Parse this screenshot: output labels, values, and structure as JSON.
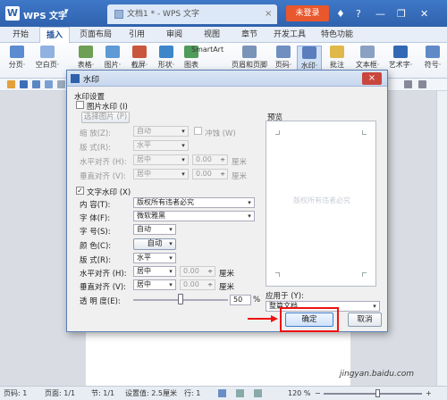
{
  "titlebar": {
    "app_logo": "W",
    "app_name": "WPS 文字",
    "menu_arrow": "▾",
    "doc_tab": "文档1 * - WPS 文字",
    "doc_tab_close": "×",
    "login_button": "未登录",
    "icons": [
      "skin-icon",
      "help-icon",
      "minimize-icon",
      "restore-icon",
      "close-icon"
    ],
    "icon_glyphs": [
      "♦",
      "?",
      "—",
      "❐",
      "✕"
    ]
  },
  "ribbon_tabs": [
    "开始",
    "插入",
    "页面布局",
    "引用",
    "审阅",
    "视图",
    "章节",
    "开发工具",
    "特色功能"
  ],
  "active_tab": "插入",
  "ribbon": {
    "groups": [
      {
        "label": "分页·",
        "color": "#5b8bd0"
      },
      {
        "label": "空白页·",
        "color": "#8fb2e0"
      },
      {
        "label": "表格·",
        "color": "#6d9f55"
      },
      {
        "label": "图片·",
        "color": "#5e9ad6"
      },
      {
        "label": "截屏·",
        "color": "#c9573d"
      },
      {
        "label": "形状·",
        "color": "#3d86c9"
      },
      {
        "label": "图表",
        "color": "#4f9c5a"
      },
      {
        "label": "页眉和页脚",
        "color": "#7a93b8"
      },
      {
        "label": "页码·",
        "color": "#6f8fc0"
      },
      {
        "label": "水印·",
        "color": "#5a7dbd"
      },
      {
        "label": "批注",
        "color": "#e0b84a"
      },
      {
        "label": "文本框·",
        "color": "#8aa1c4"
      },
      {
        "label": "艺术字·",
        "color": "#3269b5"
      },
      {
        "label": "符号·",
        "color": "#5f8ac7"
      }
    ],
    "smartart": "SmartArt"
  },
  "dialog": {
    "title": "水印",
    "close": "×",
    "section_title": "水印设置",
    "picture_watermark": {
      "checkbox_label": "图片水印 (I)",
      "select_picture": "选择图片 (P)",
      "scale_label": "缩 放(Z):",
      "scale_value": "自动",
      "washout_label": "冲蚀 (W)",
      "layout_label": "版 式(R):",
      "layout_value": "水平",
      "halign_label": "水平对齐 (H):",
      "halign_value": "居中",
      "halign_offset": "0.00",
      "valign_label": "垂直对齐 (V):",
      "valign_value": "居中",
      "valign_offset": "0.00",
      "unit": "厘米"
    },
    "preview_label": "预览",
    "preview_text": "版权所有违者必究",
    "text_watermark": {
      "checkbox_label": "文字水印 (X)",
      "checked": "✓",
      "content_label": "内 容(T):",
      "content_value": "版权所有违者必究",
      "font_label": "字 体(F):",
      "font_value": "微软雅黑",
      "size_label": "字 号(S):",
      "size_value": "自动",
      "color_label": "颜 色(C):",
      "color_value": "自动",
      "layout_label": "版 式(R):",
      "layout_value": "水平",
      "halign_label": "水平对齐 (H):",
      "halign_value": "居中",
      "halign_offset": "0.00",
      "valign_label": "垂直对齐 (V):",
      "valign_value": "居中",
      "valign_offset": "0.00",
      "unit": "厘米",
      "transparency_label": "透 明 度(E):",
      "transparency_value": "50",
      "transparency_percent": 0.5,
      "percent_sign": "%"
    },
    "apply_to_label": "应用于 (Y):",
    "apply_to_value": "整篇文档",
    "ok_button": "确定",
    "cancel_button": "取消"
  },
  "statusbar": {
    "page_num": "页码: 1",
    "page": "页面: 1/1",
    "section": "节: 1/1",
    "setting": "设置值: 2.5厘米",
    "row": "行: 1",
    "zoom": "120 %",
    "zoom_minus": "−",
    "zoom_plus": "+"
  },
  "watermark_site": "jingyan.baidu.com",
  "accent": "#2f62ad",
  "login_color": "#e9572c"
}
